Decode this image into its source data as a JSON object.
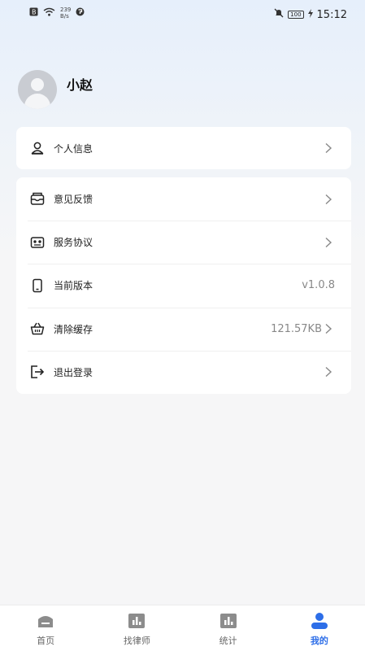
{
  "status_bar": {
    "net_speed_value": "239",
    "net_speed_unit": "B/s",
    "battery": "100",
    "time": "15:12"
  },
  "profile": {
    "username": "小赵"
  },
  "menu_primary": [
    {
      "label": "个人信息",
      "icon": "person-icon"
    }
  ],
  "menu_secondary": [
    {
      "label": "意见反馈",
      "icon": "feedback-icon"
    },
    {
      "label": "服务协议",
      "icon": "agreement-icon"
    },
    {
      "label": "当前版本",
      "icon": "phone-version-icon",
      "value": "v1.0.8"
    },
    {
      "label": "清除缓存",
      "icon": "basket-clear-icon",
      "value": "121.57KB"
    },
    {
      "label": "退出登录",
      "icon": "logout-icon"
    }
  ],
  "tabbar": {
    "items": [
      {
        "label": "首页",
        "icon": "home-icon"
      },
      {
        "label": "找律师",
        "icon": "find-lawyer-icon"
      },
      {
        "label": "统计",
        "icon": "statistics-icon"
      },
      {
        "label": "我的",
        "icon": "profile-icon",
        "active": true
      }
    ],
    "active_color": "#2d6ee8",
    "inactive_color": "#8c8c8c"
  }
}
